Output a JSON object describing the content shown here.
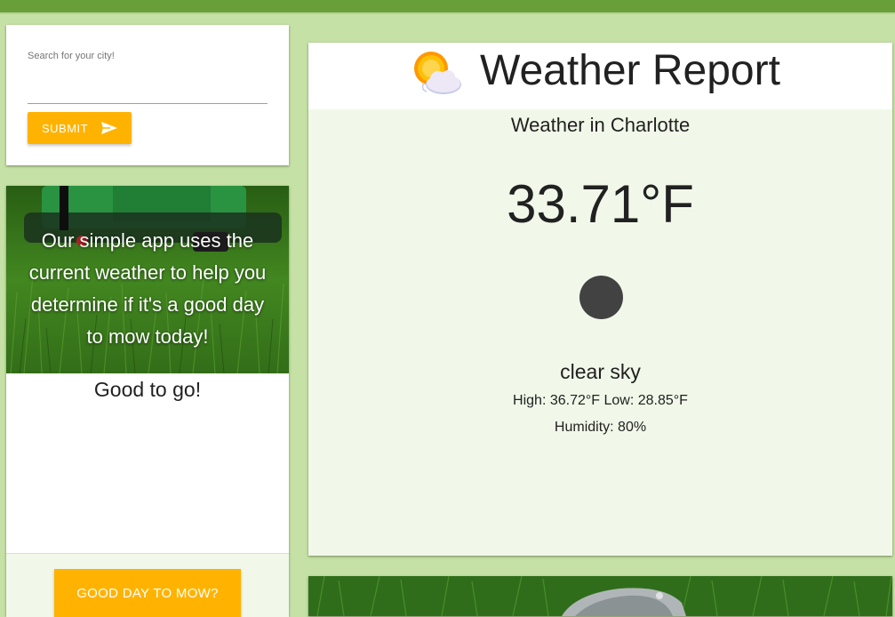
{
  "colors": {
    "topbar": "#689f38",
    "page_background": "#c5e1a5",
    "accent_button": "#ffb300",
    "weather_panel": "#f1f8e9"
  },
  "search": {
    "label": "Search for your city!",
    "value": "",
    "submit_label": "SUBMIT",
    "submit_icon": "send-icon"
  },
  "mow": {
    "intro": "Our simple app uses the current weather to help you determine if it's a good day to mow today!",
    "verdict": "Good to go!",
    "button_label": "GOOD DAY TO MOW?"
  },
  "weather": {
    "title": "Weather Report",
    "logo_icon": "sun-behind-cloud-icon",
    "city_line": "Weather in Charlotte",
    "temperature": "33.71°F",
    "condition_icon": "weather-condition-icon",
    "description": "clear sky",
    "high_low": "High: 36.72°F Low: 28.85°F",
    "humidity": "Humidity: 80%"
  }
}
